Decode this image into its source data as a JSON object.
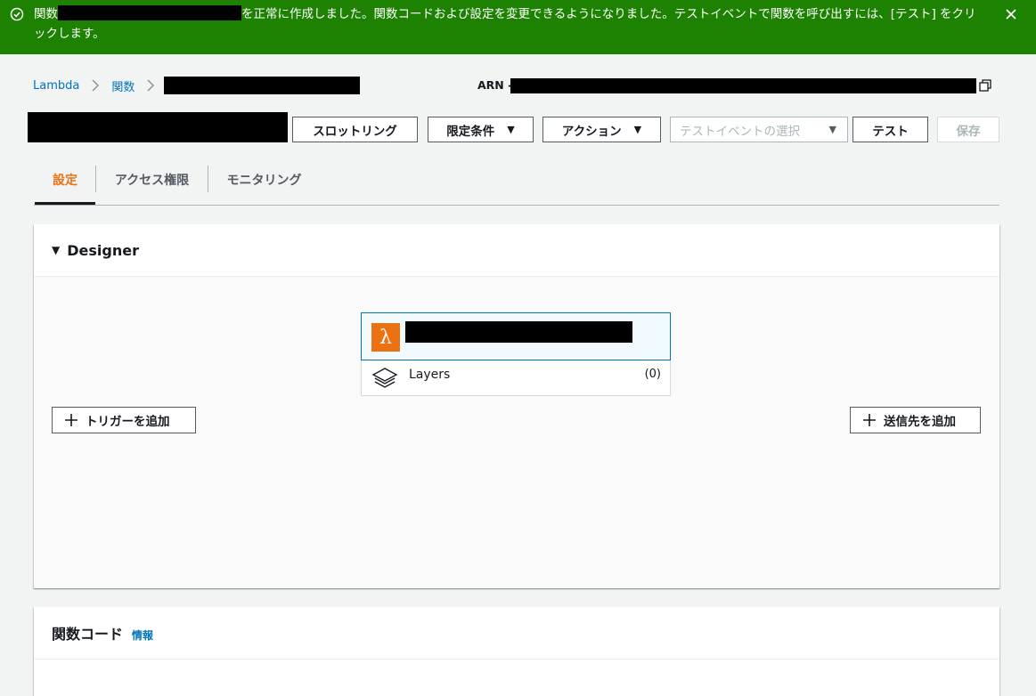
{
  "banner": {
    "pre_text": "関数",
    "message": "を正常に作成しました。関数コードおよび設定を変更できるようになりました。テストイベントで関数を呼び出すには、[テスト] をクリックします。",
    "color": "#1d8102"
  },
  "breadcrumb": {
    "items": [
      "Lambda",
      "関数"
    ]
  },
  "arn_label": "ARN -",
  "toolbar": {
    "throttle_label": "スロットリング",
    "qualifiers_label": "限定条件",
    "actions_label": "アクション",
    "test_event_placeholder": "テストイベントの選択",
    "test_label": "テスト",
    "save_label": "保存"
  },
  "tabs": [
    {
      "label": "設定",
      "active": true
    },
    {
      "label": "アクセス権限",
      "active": false
    },
    {
      "label": "モニタリング",
      "active": false
    }
  ],
  "designer": {
    "title": "Designer",
    "layers_label": "Layers",
    "layers_count": "(0)",
    "add_trigger_label": "トリガーを追加",
    "add_destination_label": "送信先を追加"
  },
  "code_panel": {
    "title": "関数コード",
    "info_label": "情報"
  },
  "icons": [
    "check-circle-icon",
    "close-icon",
    "chevron-right-icon",
    "copy-icon",
    "caret-down-icon",
    "lambda-icon",
    "layers-icon",
    "plus-icon"
  ],
  "accent": "#ec7211",
  "link_color": "#0073bb"
}
